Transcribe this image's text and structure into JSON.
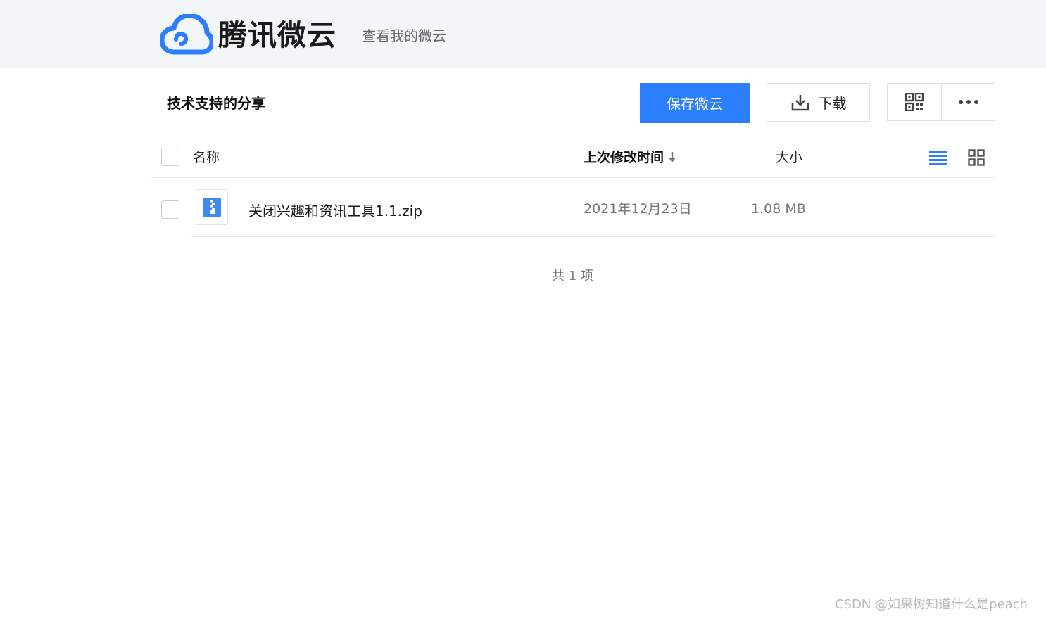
{
  "header": {
    "brand": "腾讯微云",
    "my_link": "查看我的微云",
    "brand_color": "#2b7fff"
  },
  "share": {
    "title": "技术支持的分享"
  },
  "toolbar": {
    "save_label": "保存微云",
    "download_label": "下载",
    "download_icon": "download-icon",
    "qrcode_icon": "qrcode-icon",
    "more_icon": "more-icon"
  },
  "columns": {
    "name": "名称",
    "modified": "上次修改时间",
    "size": "大小",
    "sort_icon": "arrow-down-icon"
  },
  "view": {
    "list_icon": "list-view-icon",
    "grid_icon": "grid-view-icon",
    "active": "list"
  },
  "files": [
    {
      "name": "关闭兴趣和资讯工具1.1.zip",
      "modified": "2021年12月23日",
      "size": "1.08 MB",
      "icon": "zip-file-icon"
    }
  ],
  "footer": {
    "total": "共 1 项"
  },
  "watermark": "CSDN @如果树知道什么是peach"
}
